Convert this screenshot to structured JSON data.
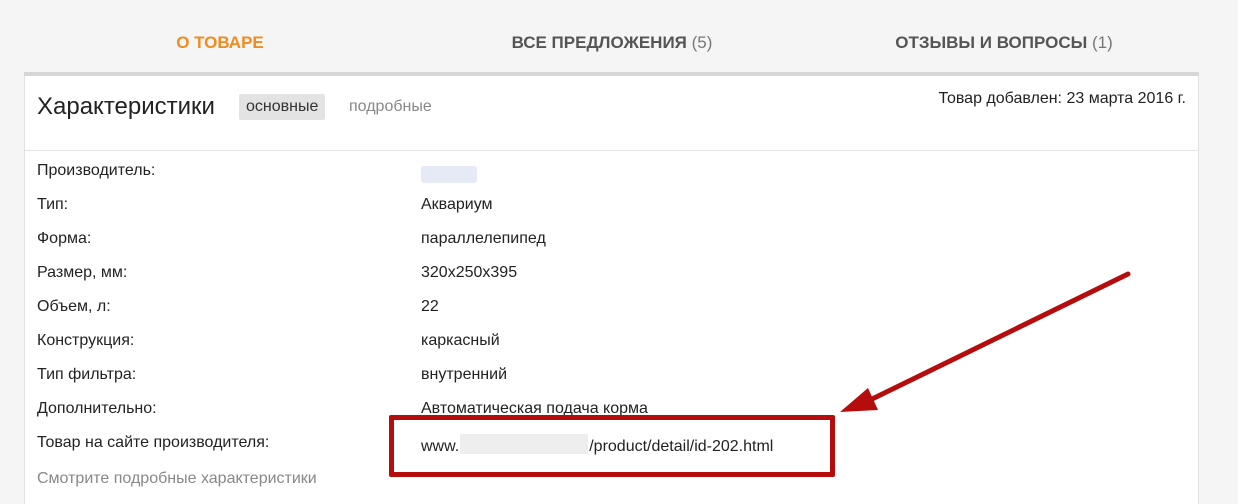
{
  "tabs": [
    {
      "label": "О ТОВАРЕ",
      "count": "",
      "active": true
    },
    {
      "label": "ВСЕ ПРЕДЛОЖЕНИЯ",
      "count": "(5)",
      "active": false
    },
    {
      "label": "ОТЗЫВЫ И ВОПРОСЫ",
      "count": "(1)",
      "active": false
    }
  ],
  "header": {
    "title": "Характеристики",
    "basic_label": "основные",
    "detailed_label": "подробные",
    "added": "Товар добавлен: 23 марта 2016 г."
  },
  "specs": [
    {
      "key": "Производитель:",
      "value": ""
    },
    {
      "key": "Тип:",
      "value": "Аквариум"
    },
    {
      "key": "Форма:",
      "value": "параллелепипед"
    },
    {
      "key": "Размер, мм:",
      "value": "320x250x395"
    },
    {
      "key": "Объем, л:",
      "value": "22"
    },
    {
      "key": "Конструкция:",
      "value": "каркасный"
    },
    {
      "key": "Тип фильтра:",
      "value": "внутренний"
    },
    {
      "key": "Дополнительно:",
      "value": "Автоматическая подача корма"
    },
    {
      "key": "Товар на сайте производителя:",
      "value": ""
    }
  ],
  "manufacturer_link": {
    "prefix": "www.",
    "suffix": "/product/detail/id-202.html"
  },
  "more_label": "Смотрите подробные характеристики",
  "colors": {
    "accent": "#f08c1e",
    "link": "#3a6fc6",
    "annotation": "#b50d0d"
  }
}
